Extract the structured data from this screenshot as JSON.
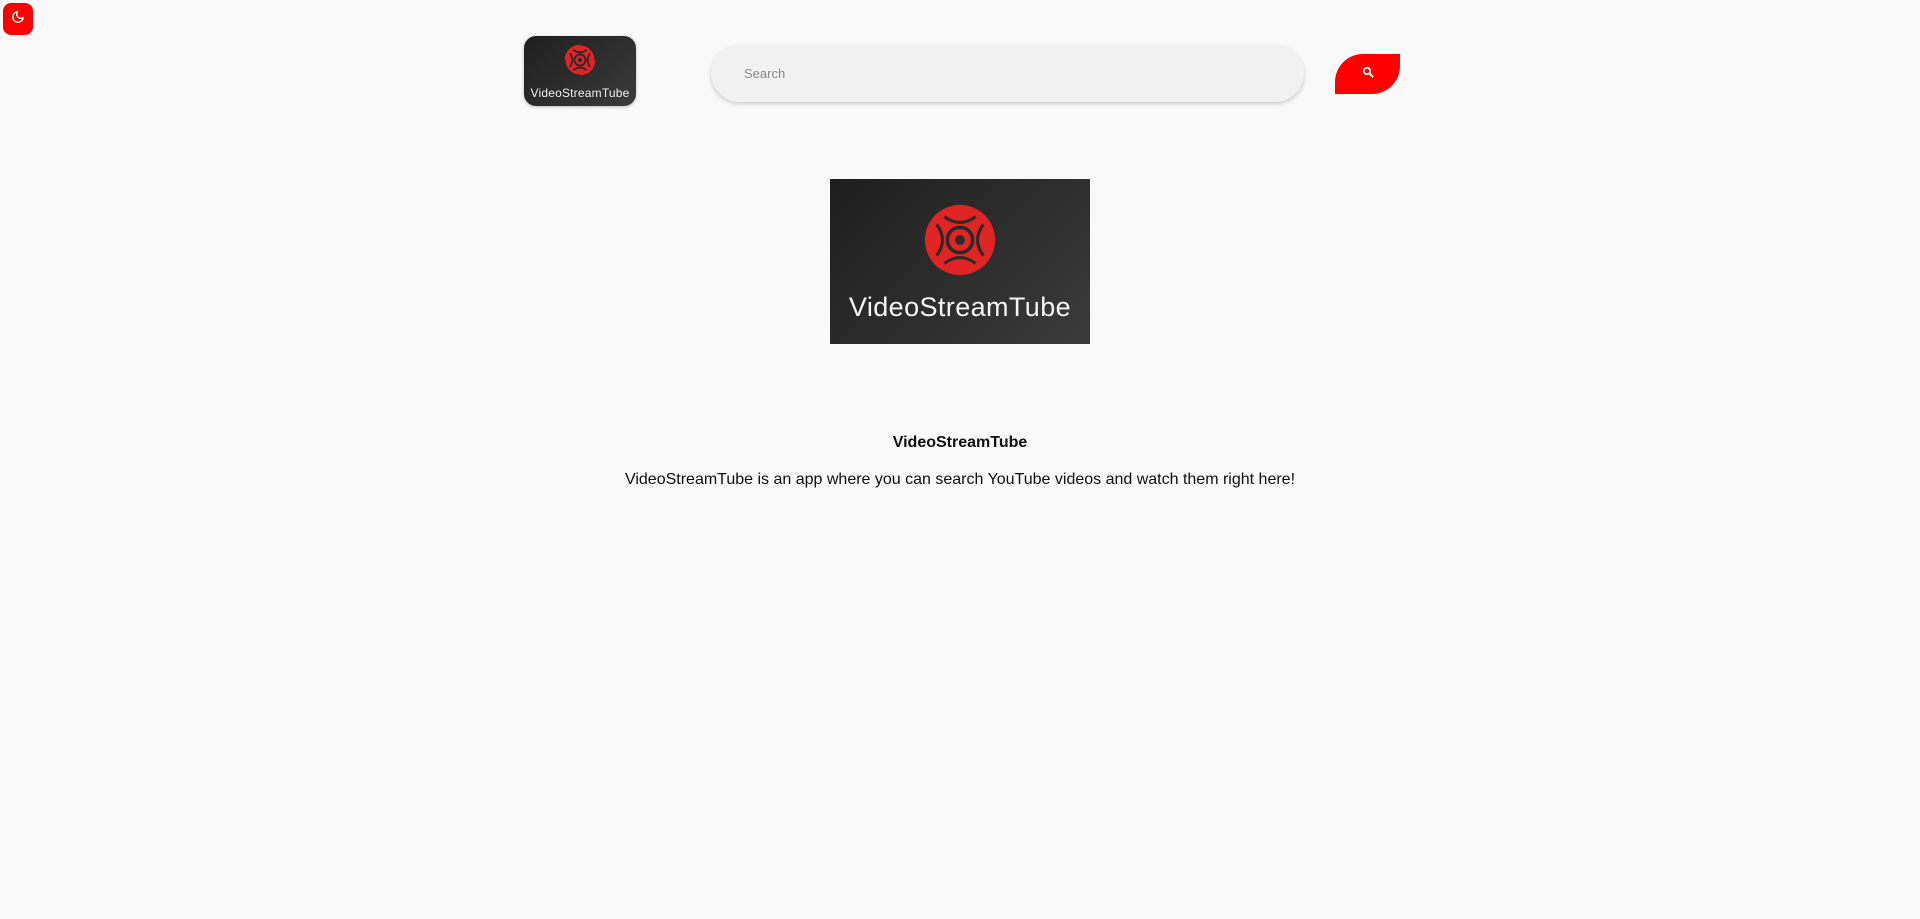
{
  "theme_toggle": {
    "icon": "moon-icon",
    "color": "#ff0000"
  },
  "header": {
    "logo_text": "VideoStreamTube",
    "search": {
      "placeholder": "Search",
      "value": ""
    },
    "search_button": {
      "icon": "search-icon",
      "color": "#ff0000"
    }
  },
  "main": {
    "hero_logo_text": "VideoStreamTube",
    "about_title": "VideoStreamTube",
    "about_text": "VideoStreamTube is an app where you can search YouTube videos and watch them right here!"
  },
  "colors": {
    "accent": "#ff0000",
    "logo_red": "#e02424",
    "logo_bg": "#2a2a2a",
    "page_bg": "#f9f9f9"
  }
}
